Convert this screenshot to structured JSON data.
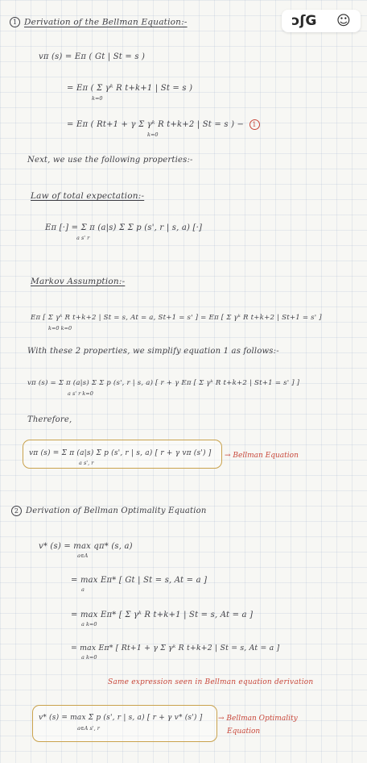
{
  "toolbar": {
    "left_icon": "handwriting-pen-icon",
    "left_text": "ↄʃǤ",
    "right_icon": "smiley-reaction-icon",
    "right_text": "☺"
  },
  "section1": {
    "number": "1",
    "title": "Derivation of the Bellman Equation:-",
    "eq1": "vπ (s) =  Eπ ( Gt | St = s )",
    "eq2": "= Eπ ( Σ γᵏ R t+k+1 | St = s )",
    "eq2_sub": "k=0",
    "eq3": "= Eπ ( Rt+1 + γ Σ γᵏ R t+k+2 | St = s ) −",
    "eq3_sub": "k=0",
    "eq3_tag": "1",
    "next": "Next, we use the following properties:-",
    "law_title": "Law of total expectation:-",
    "law_eq": "Eπ [·] =  Σ π (a|s) Σ Σ  p (s', r | s, a) [·]",
    "law_sub": "a          s'  r",
    "markov_title": "Markov Assumption:-",
    "markov_eq": "Eπ [ Σ γᵏ R t+k+2 | St = s, At = a, St+1 = s' ] = Eπ [ Σ γᵏ R t+k+2 | St+1 = s' ]",
    "markov_sub": "k=0                                                   k=0",
    "with_text": "With these 2 properties, we simplify equation 1 as follows:-",
    "simplified_eq": "vπ (s) =  Σ π (a|s) Σ Σ  p (s', r | s, a) [ r + γ Eπ [ Σ γᵏ R t+k+2 | St+1 = s' ] ]",
    "simplified_sub": "a          s'  r                                         k=0",
    "therefore": "Therefore,",
    "bellman_eq": "vπ (s) =  Σ π (a|s) Σ  p (s', r | s, a) [ r + γ vπ (s') ]",
    "bellman_sub": "a             s', r",
    "bellman_label": "Bellman Equation"
  },
  "section2": {
    "number": "2",
    "title": "Derivation of Bellman Optimality Equation",
    "eq1": "v* (s) =   max  qπ* (s, a)",
    "eq1_sub": "a∈A",
    "eq2": "=   max  Eπ* [ Gt | St = s, At = a ]",
    "eq2_sub": "a",
    "eq3": "=   max  Eπ* [ Σ γᵏ R t+k+1 | St = s, At = a ]",
    "eq3_sub": "a              k=0",
    "eq4": "=   max  Eπ* [ Rt+1 + γ Σ γᵏ R t+k+2 | St = s, At = a ]",
    "eq4_sub": "a                          k=0",
    "same_note": "Same expression seen in Bellman equation derivation",
    "optimality_eq": "v* (s) =   max Σ   p (s', r | s, a) [ r + γ v* (s') ]",
    "optimality_sub": "a∈A  s', r",
    "optimality_label_1": "Bellman Optimality",
    "optimality_label_2": "Equation"
  }
}
